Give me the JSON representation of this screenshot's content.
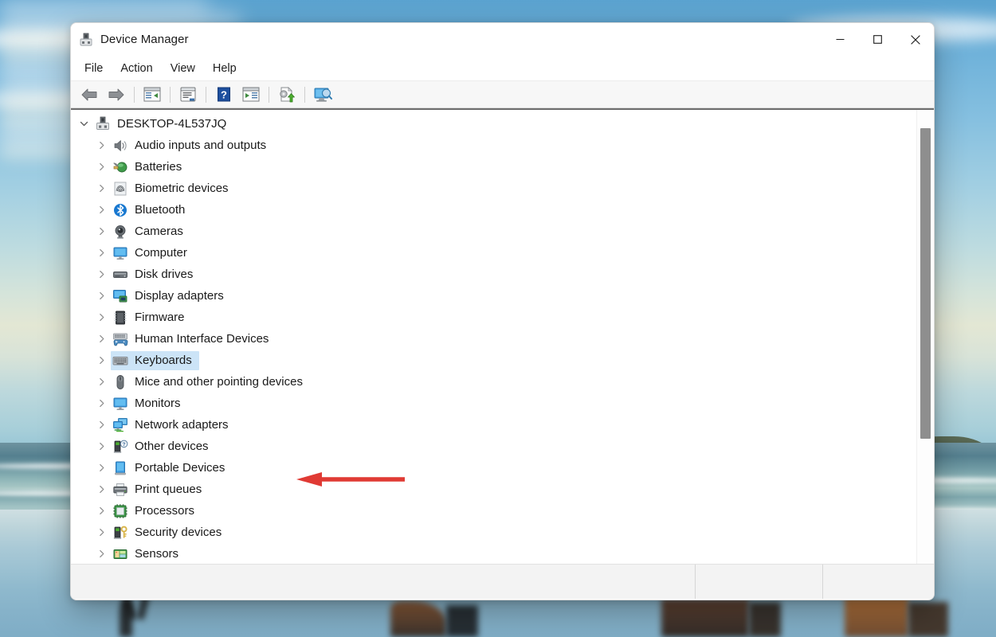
{
  "window": {
    "title": "Device Manager",
    "app_icon": "device-manager-icon",
    "controls": {
      "minimize": "minimize-button",
      "maximize": "maximize-button",
      "close": "close-button"
    }
  },
  "menubar": {
    "items": [
      {
        "label": "File"
      },
      {
        "label": "Action"
      },
      {
        "label": "View"
      },
      {
        "label": "Help"
      }
    ]
  },
  "toolbar": {
    "buttons": [
      {
        "name": "back-icon",
        "title": "Back"
      },
      {
        "name": "forward-icon",
        "title": "Forward"
      },
      {
        "name": "show-hide-console-tree-icon",
        "title": "Show/Hide Console Tree"
      },
      {
        "name": "properties-icon",
        "title": "Properties"
      },
      {
        "name": "help-icon",
        "title": "Help"
      },
      {
        "name": "show-hide-action-pane-icon",
        "title": "Show/Hide Action Pane"
      },
      {
        "name": "update-driver-icon",
        "title": "Update Driver Software"
      },
      {
        "name": "scan-hardware-changes-icon",
        "title": "Scan for hardware changes"
      }
    ]
  },
  "tree": {
    "root": {
      "label": "DESKTOP-4L537JQ",
      "icon": "computer-root-icon",
      "expanded": true,
      "chevron": "chevron-down"
    },
    "items": [
      {
        "label": "Audio inputs and outputs",
        "icon": "speaker-icon",
        "chevron": "chevron-right",
        "selected": false
      },
      {
        "label": "Batteries",
        "icon": "battery-icon",
        "chevron": "chevron-right",
        "selected": false
      },
      {
        "label": "Biometric devices",
        "icon": "fingerprint-icon",
        "chevron": "chevron-right",
        "selected": false
      },
      {
        "label": "Bluetooth",
        "icon": "bluetooth-icon",
        "chevron": "chevron-right",
        "selected": false
      },
      {
        "label": "Cameras",
        "icon": "camera-icon",
        "chevron": "chevron-right",
        "selected": false
      },
      {
        "label": "Computer",
        "icon": "monitor-icon",
        "chevron": "chevron-right",
        "selected": false
      },
      {
        "label": "Disk drives",
        "icon": "disk-drive-icon",
        "chevron": "chevron-right",
        "selected": false
      },
      {
        "label": "Display adapters",
        "icon": "display-adapter-icon",
        "chevron": "chevron-right",
        "selected": false
      },
      {
        "label": "Firmware",
        "icon": "firmware-chip-icon",
        "chevron": "chevron-right",
        "selected": false
      },
      {
        "label": "Human Interface Devices",
        "icon": "hid-icon",
        "chevron": "chevron-right",
        "selected": false
      },
      {
        "label": "Keyboards",
        "icon": "keyboard-icon",
        "chevron": "chevron-right",
        "selected": true
      },
      {
        "label": "Mice and other pointing devices",
        "icon": "mouse-icon",
        "chevron": "chevron-right",
        "selected": false
      },
      {
        "label": "Monitors",
        "icon": "monitor-icon",
        "chevron": "chevron-right",
        "selected": false
      },
      {
        "label": "Network adapters",
        "icon": "network-adapter-icon",
        "chevron": "chevron-right",
        "selected": false
      },
      {
        "label": "Other devices",
        "icon": "other-device-question-icon",
        "chevron": "chevron-right",
        "selected": false
      },
      {
        "label": "Portable Devices",
        "icon": "portable-device-icon",
        "chevron": "chevron-right",
        "selected": false
      },
      {
        "label": "Print queues",
        "icon": "printer-icon",
        "chevron": "chevron-right",
        "selected": false
      },
      {
        "label": "Processors",
        "icon": "processor-icon",
        "chevron": "chevron-right",
        "selected": false
      },
      {
        "label": "Security devices",
        "icon": "security-key-icon",
        "chevron": "chevron-right",
        "selected": false
      },
      {
        "label": "Sensors",
        "icon": "sensor-icon",
        "chevron": "chevron-right",
        "selected": false
      }
    ]
  },
  "annotation": {
    "arrow": "red-pointer-arrow",
    "points_at": "Keyboards",
    "color": "#e03a34"
  },
  "colors": {
    "selection": "#cce4f7",
    "annotation_red": "#e03a34",
    "scrollbar_thumb": "#8e8e8e",
    "toolbar_bg": "#f7f7f7",
    "statusbar_bg": "#f3f3f3"
  },
  "scrollbar": {
    "orientation": "vertical",
    "thumb_position_percent": 4
  }
}
